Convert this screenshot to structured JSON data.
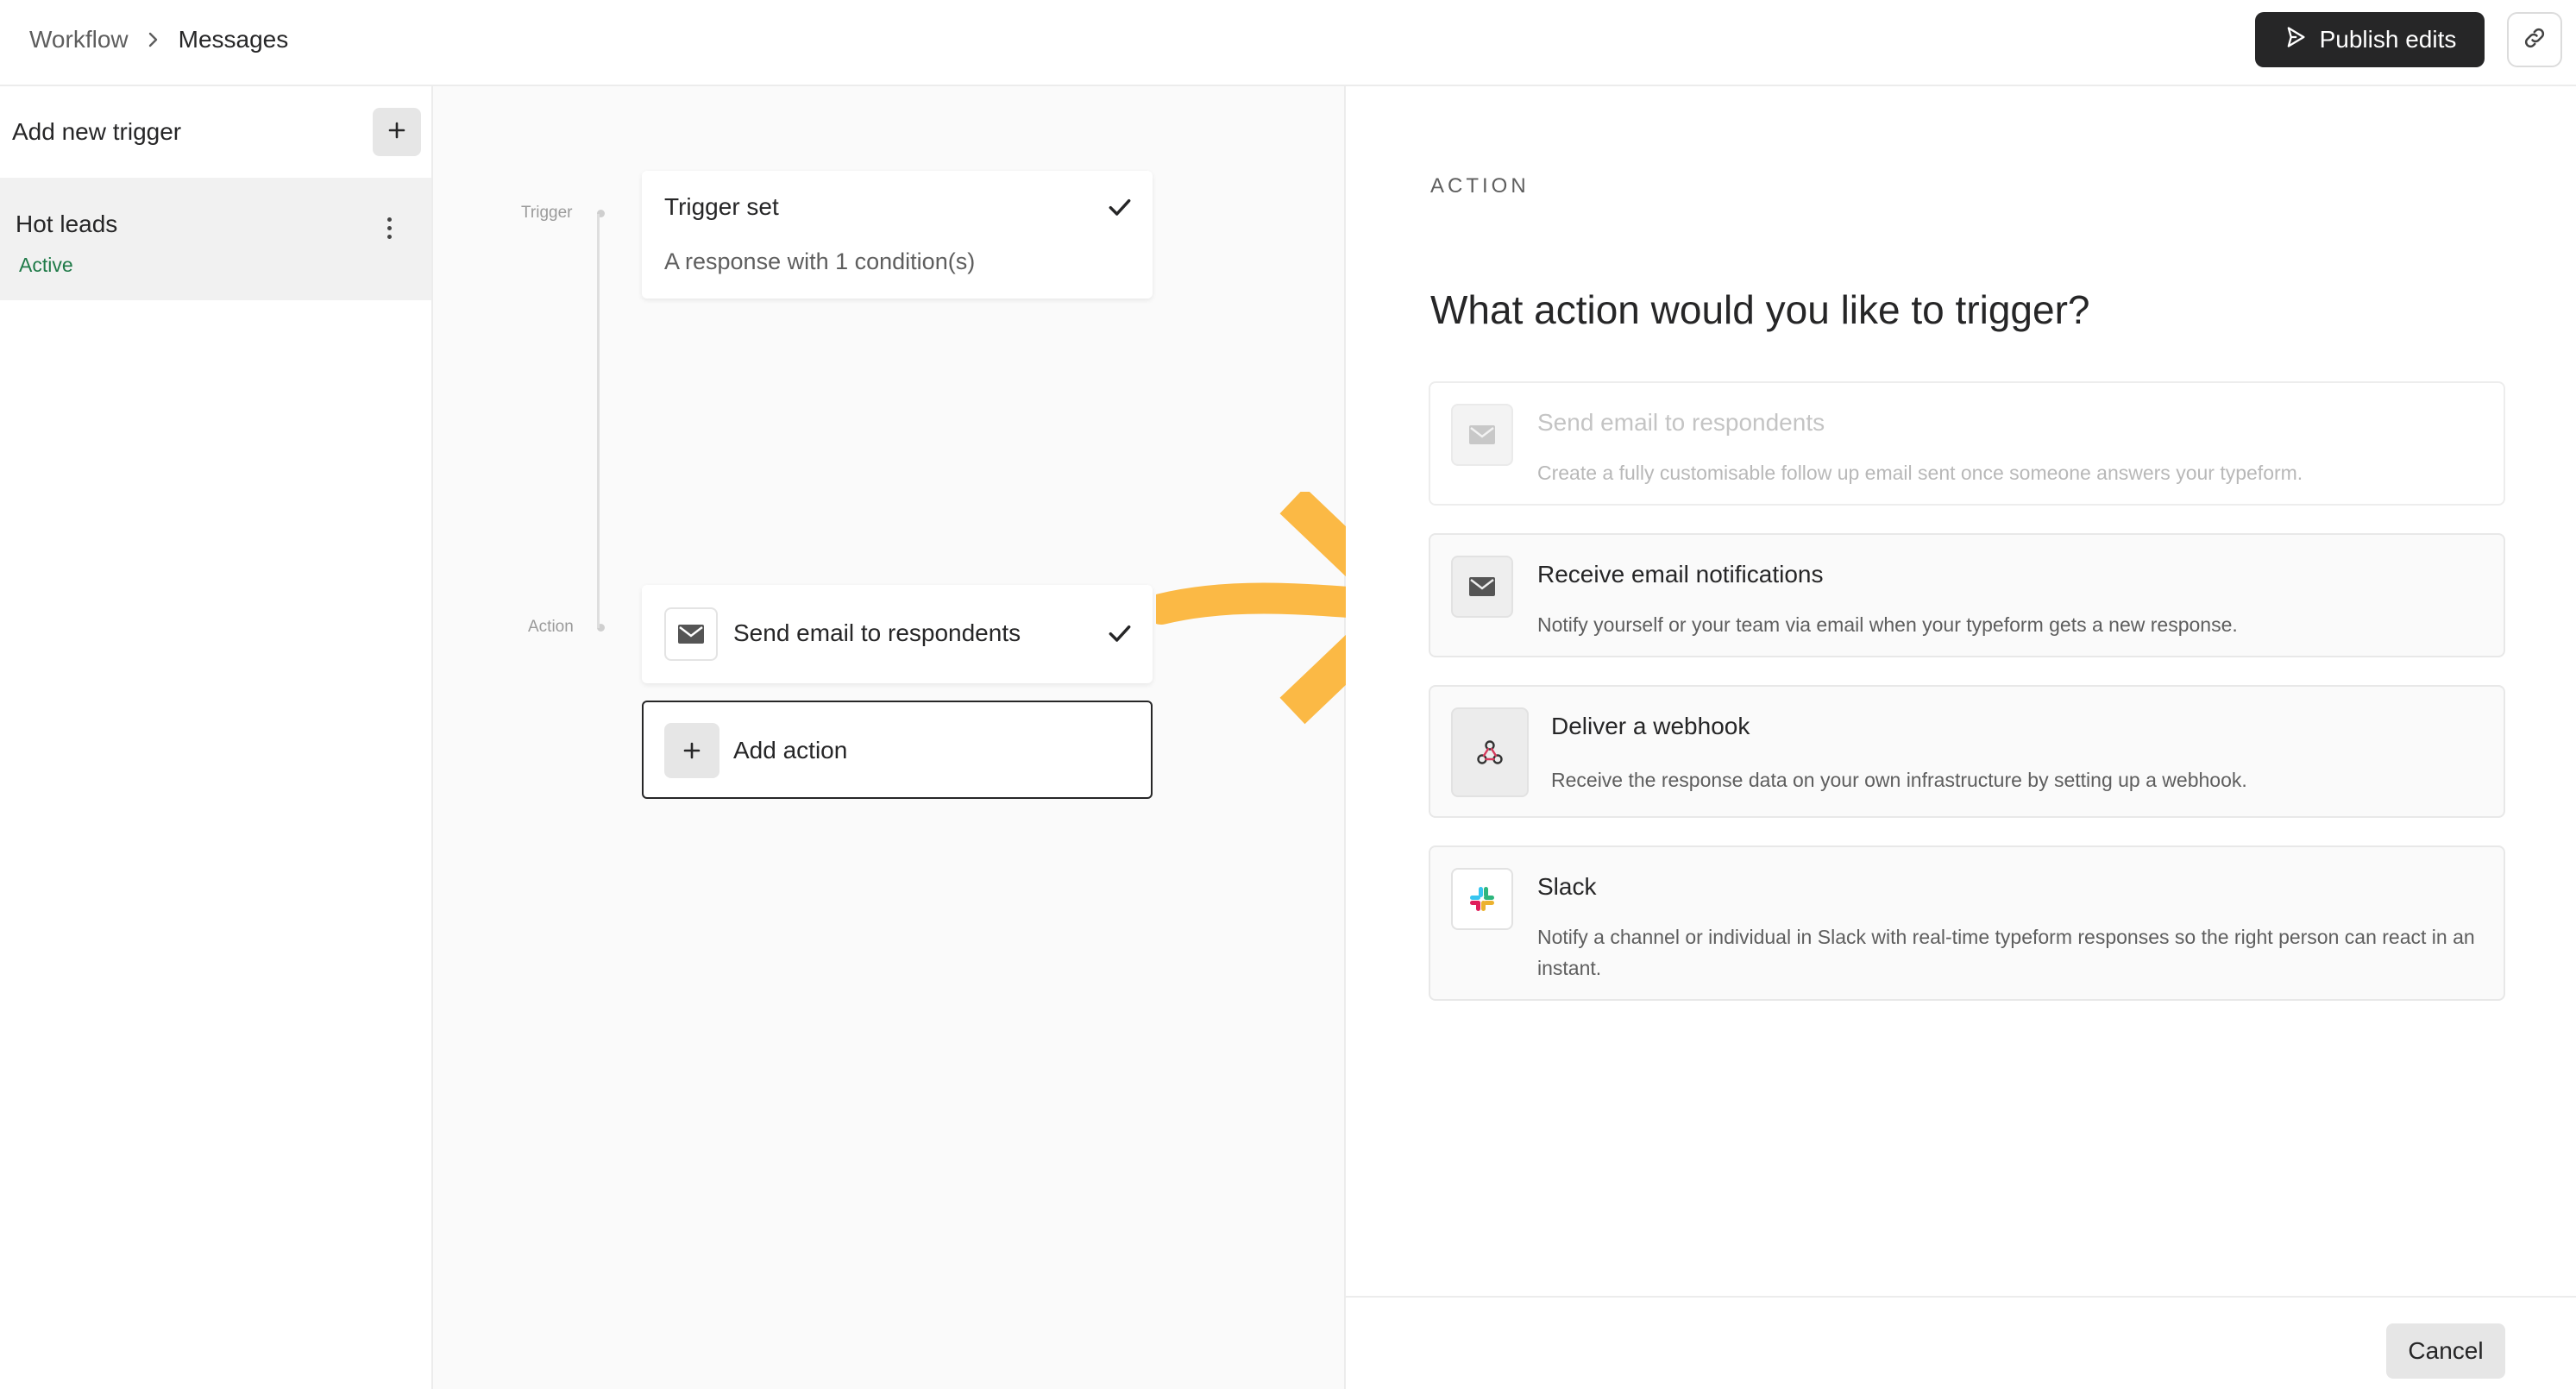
{
  "header": {
    "breadcrumb_root": "Workflow",
    "breadcrumb_current": "Messages",
    "publish_label": "Publish edits"
  },
  "sidebar": {
    "title": "Add new trigger",
    "items": [
      {
        "name": "Hot leads",
        "status": "Active"
      }
    ]
  },
  "canvas": {
    "trigger_label": "Trigger",
    "action_label": "Action",
    "trigger_card": {
      "title": "Trigger set",
      "subtitle": "A response with 1 condition(s)"
    },
    "action_card": {
      "title": "Send email to respondents"
    },
    "add_action_label": "Add action"
  },
  "panel": {
    "eyebrow": "ACTION",
    "heading": "What action would you like to trigger?",
    "options": [
      {
        "title": "Send email to respondents",
        "description": "Create a fully customisable follow up email sent once someone answers your typeform.",
        "icon": "envelope-icon"
      },
      {
        "title": "Receive email notifications",
        "description": "Notify yourself or your team via email when your typeform gets a new response.",
        "icon": "envelope-icon"
      },
      {
        "title": "Deliver a webhook",
        "description": "Receive the response data on your own infrastructure by setting up a webhook.",
        "icon": "webhook-icon"
      },
      {
        "title": "Slack",
        "description": "Notify a channel or individual in Slack with real-time typeform responses so the right person can react in an instant.",
        "icon": "slack-icon"
      }
    ],
    "cancel_label": "Cancel"
  },
  "colors": {
    "primary_dark": "#262627",
    "active_green": "#1f7a48",
    "arrow": "#fbb945"
  }
}
